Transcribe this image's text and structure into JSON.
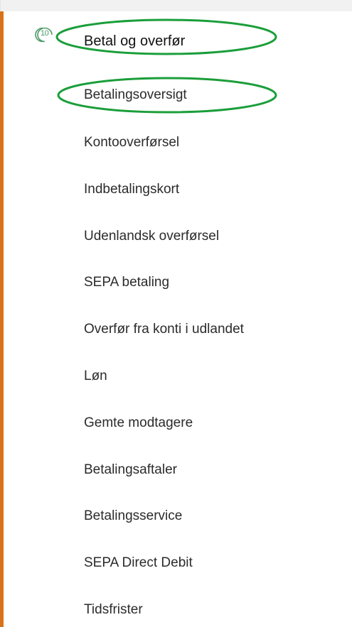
{
  "colors": {
    "accent_bar": "#d9731a",
    "highlight": "#1a9e3a",
    "badge": "#4c9a68",
    "top_band": "#f1f1f1"
  },
  "section": {
    "step_number": "10",
    "title": "Betal og overfør",
    "icon": "step-number-badge-icon"
  },
  "menu_items": [
    {
      "label": "Betalingsoversigt",
      "highlighted": true
    },
    {
      "label": "Kontooverførsel"
    },
    {
      "label": "Indbetalingskort"
    },
    {
      "label": "Udenlandsk overførsel"
    },
    {
      "label": "SEPA betaling"
    },
    {
      "label": "Overfør fra konti i udlandet"
    },
    {
      "label": "Løn"
    },
    {
      "label": "Gemte modtagere"
    },
    {
      "label": "Betalingsaftaler"
    },
    {
      "label": "Betalingsservice"
    },
    {
      "label": "SEPA Direct Debit"
    },
    {
      "label": "Tidsfrister"
    }
  ]
}
